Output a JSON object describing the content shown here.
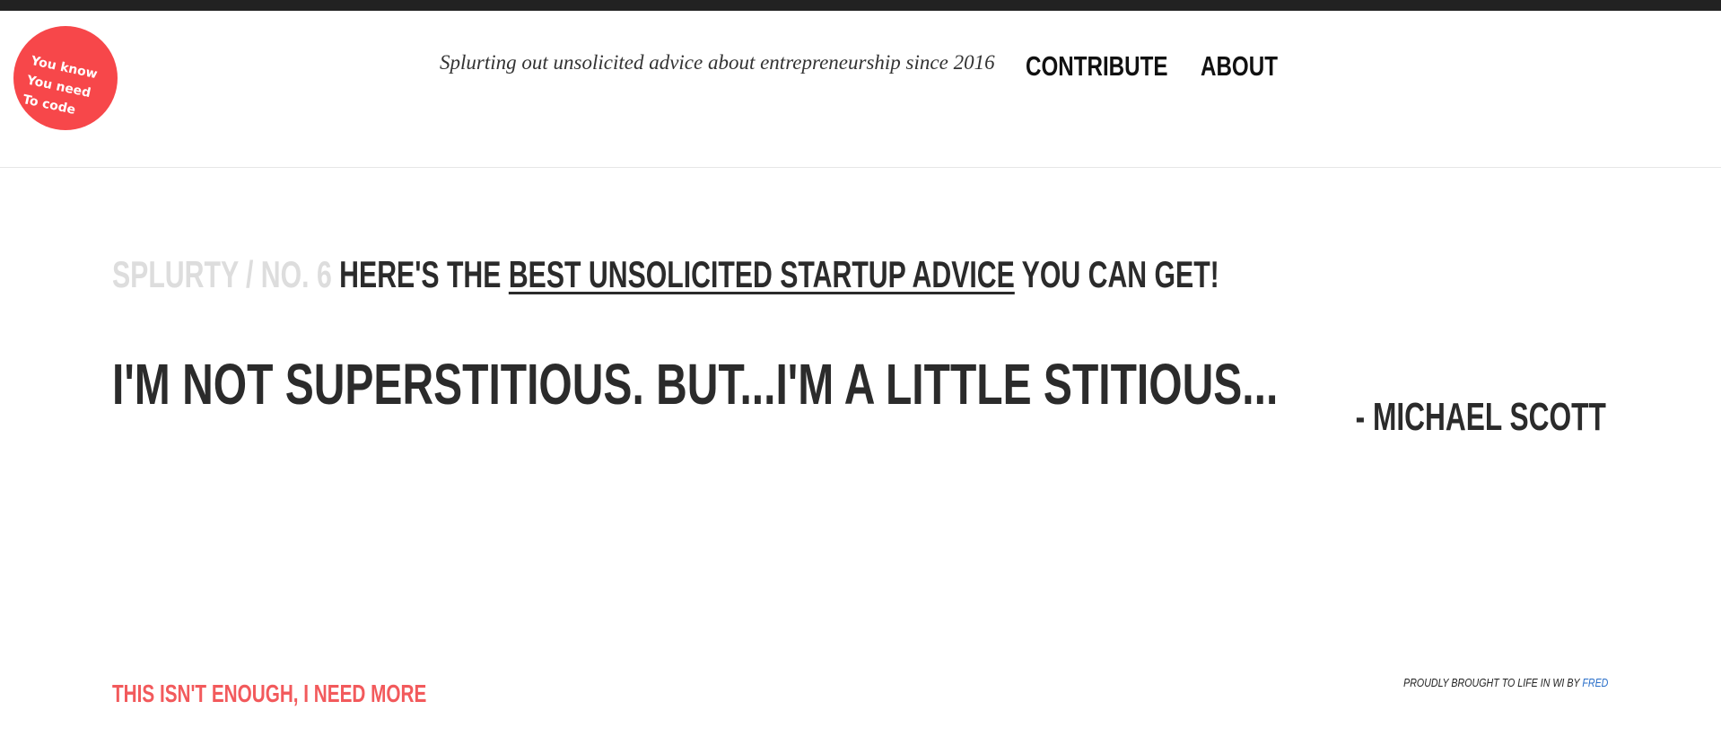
{
  "logo": {
    "lines": [
      "You know",
      "You need",
      "To code"
    ],
    "color": "#f7474a"
  },
  "header": {
    "tagline": "Splurting out unsolicited advice about entrepreneurship since 2016",
    "nav": {
      "contribute": "CONTRIBUTE",
      "about": "ABOUT"
    }
  },
  "headline": {
    "prefix": "SPLURTY / NO. 6",
    "before_link": "HERE'S THE",
    "link": "BEST UNSOLICITED STARTUP ADVICE",
    "after_link": "YOU CAN GET!"
  },
  "quote": {
    "text": "I'M NOT SUPERSTITIOUS. BUT...I'M A LITTLE STITIOUS...",
    "author": "- MICHAEL SCOTT"
  },
  "footer": {
    "more_link": "THIS ISN'T ENOUGH, I NEED MORE",
    "credit_prefix": "PROUDLY BROUGHT TO LIFE IN WI BY",
    "credit_link": "FRED",
    "more_color": "#f25a5c",
    "credit_link_color": "#2a6fc9"
  }
}
